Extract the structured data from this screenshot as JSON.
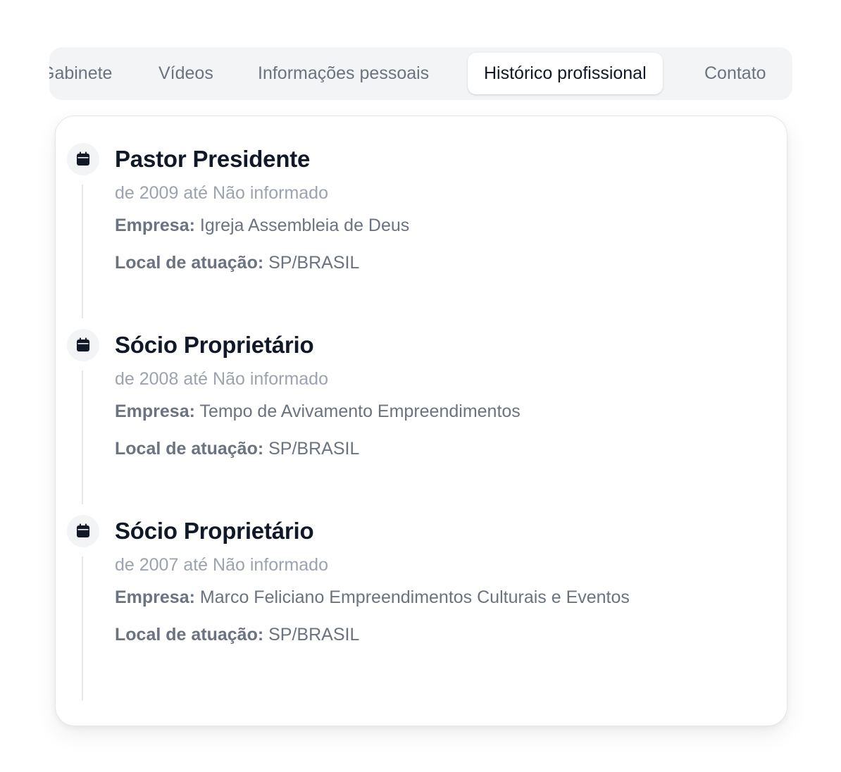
{
  "tabs": [
    {
      "label": "Gabinete",
      "active": false
    },
    {
      "label": "Vídeos",
      "active": false
    },
    {
      "label": "Informações pessoais",
      "active": false
    },
    {
      "label": "Histórico profissional",
      "active": true
    },
    {
      "label": "Contato",
      "active": false
    }
  ],
  "labels": {
    "company": "Empresa:",
    "location": "Local de atuação:"
  },
  "entries": [
    {
      "title": "Pastor Presidente",
      "period": "de 2009 até Não informado",
      "company": "Igreja Assembleia de Deus",
      "location": "SP/BRASIL",
      "icon": "calendar-icon"
    },
    {
      "title": "Sócio Proprietário",
      "period": "de 2008 até Não informado",
      "company": "Tempo de Avivamento Empreendimentos",
      "location": "SP/BRASIL",
      "icon": "calendar-icon"
    },
    {
      "title": "Sócio Proprietário",
      "period": "de 2007 até Não informado",
      "company": "Marco Feliciano Empreendimentos Culturais e Eventos",
      "location": "SP/BRASIL",
      "icon": "calendar-icon"
    }
  ],
  "colors": {
    "tab_bar_bg": "#f3f4f6",
    "active_tab_bg": "#ffffff",
    "title_text": "#111827",
    "muted_text": "#6b7280",
    "period_text": "#9ca3af",
    "timeline_line": "#e5e7eb"
  }
}
